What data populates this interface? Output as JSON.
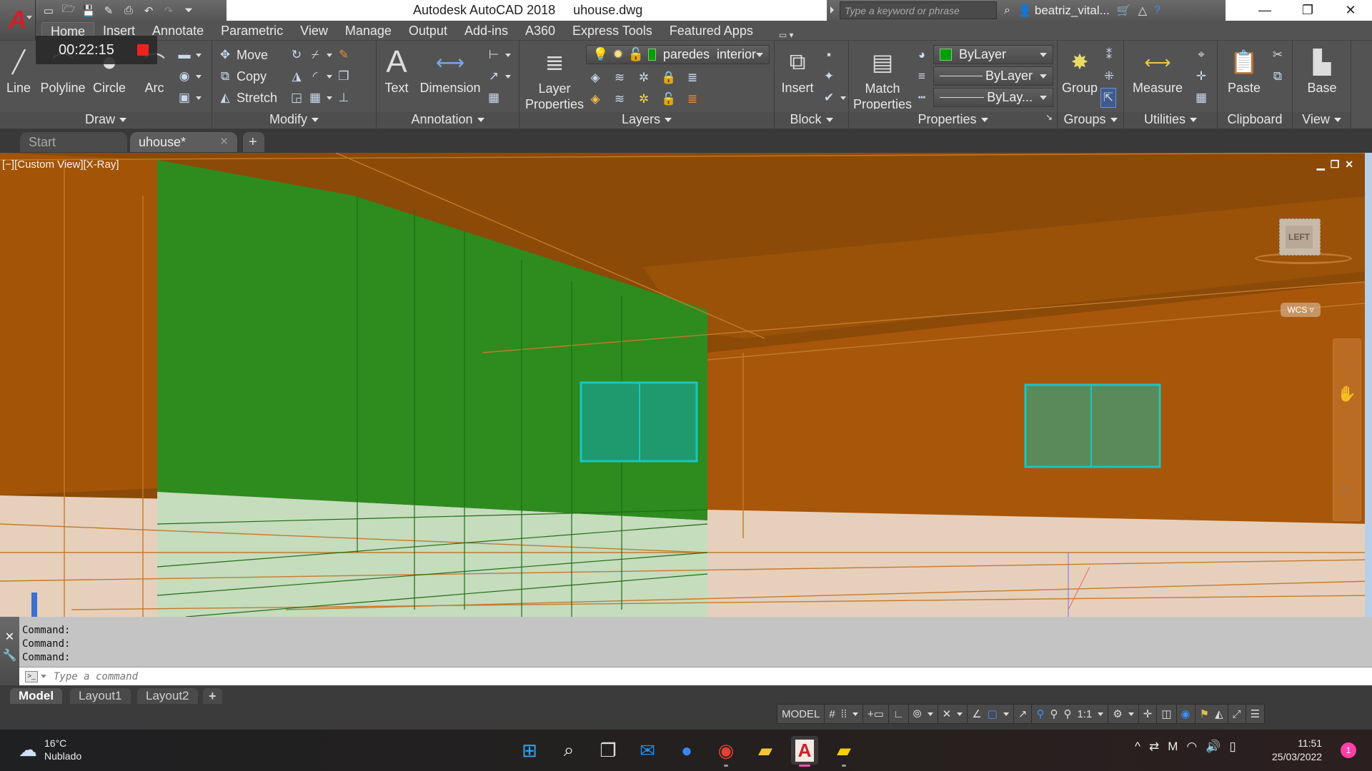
{
  "titlebar": {
    "app_menu_icon": "autocad-logo-icon",
    "app_name": "Autodesk AutoCAD 2018",
    "file_name": "uhouse.dwg",
    "quick_access": [
      "new-icon",
      "open-icon",
      "save-icon",
      "save-as-icon",
      "plot-icon",
      "undo-icon",
      "redo-icon",
      "customize-icon"
    ],
    "search_placeholder": "Type a keyword or phrase",
    "user_name": "beatriz_vital...",
    "window_controls": [
      "minimize",
      "restore",
      "close"
    ]
  },
  "ribbon_tabs": [
    "Home",
    "Insert",
    "Annotate",
    "Parametric",
    "View",
    "Manage",
    "Output",
    "Add-ins",
    "A360",
    "Express Tools",
    "Featured Apps"
  ],
  "ribbon_active_tab": "Home",
  "recorder": {
    "time": "00:22:15"
  },
  "panels": {
    "draw": {
      "title": "Draw",
      "buttons": [
        "Line",
        "Polyline",
        "Circle",
        "Arc"
      ]
    },
    "modify": {
      "title": "Modify",
      "buttons": [
        "Move",
        "Copy",
        "Stretch"
      ]
    },
    "annotation": {
      "title": "Annotation",
      "buttons": [
        "Text",
        "Dimension"
      ]
    },
    "layers": {
      "title": "Layers",
      "button": "Layer Properties",
      "current_layer": "paredes  interior",
      "current_layer_color": "#00a000"
    },
    "block": {
      "title": "Block",
      "button": "Insert"
    },
    "properties": {
      "title": "Properties",
      "button": "Match Properties",
      "color": "ByLayer",
      "lineweight": "ByLayer",
      "linetype": "ByLay...",
      "color_swatch": "#00a000"
    },
    "groups": {
      "title": "Groups",
      "button": "Group"
    },
    "utilities": {
      "title": "Utilities",
      "button": "Measure"
    },
    "clipboard": {
      "title": "Clipboard",
      "button": "Paste"
    },
    "view": {
      "title": "View",
      "button": "Base"
    }
  },
  "file_tabs": {
    "start": "Start",
    "active": "uhouse*",
    "new_tab": "+"
  },
  "viewport": {
    "label": "[−][Custom View][X-Ray]",
    "viewcube_face": "LEFT",
    "ucs_menu": "WCS",
    "colors": {
      "wall": "#a8560a",
      "ceiling": "#8b4a08",
      "green_wall": "#2e8b1e",
      "floor": "#e8d2bd",
      "window": "#1e9a6e",
      "window_edge": "#19c7c0"
    }
  },
  "command_line": {
    "history": [
      "Command:",
      "Command:",
      "Command:"
    ],
    "placeholder": "Type a command"
  },
  "layout_tabs": [
    "Model",
    "Layout1",
    "Layout2",
    "+"
  ],
  "layout_active": "Model",
  "status_bar": {
    "space": "MODEL",
    "annotation_scale": "1:1"
  },
  "taskbar": {
    "weather_temp": "16°C",
    "weather_desc": "Nublado",
    "apps": [
      "windows-start",
      "search",
      "task-view",
      "mail",
      "zoom",
      "chrome",
      "file-explorer",
      "autocad",
      "sticky-notes"
    ],
    "active_app": "autocad",
    "time": "11:51",
    "date": "25/03/2022",
    "notifications": "1"
  }
}
